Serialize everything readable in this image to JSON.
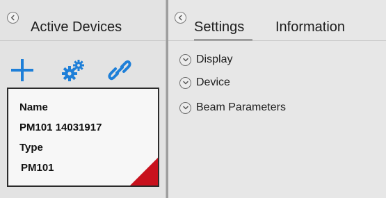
{
  "left_panel": {
    "title": "Active Devices",
    "toolbar": {
      "add_icon": "plus-icon",
      "settings_icon": "gears-icon",
      "connect_icon": "link-icon"
    },
    "device_card": {
      "name_label": "Name",
      "name_value": "PM101 14031917",
      "type_label": "Type",
      "type_value": "PM101",
      "corner_color": "#c8111d"
    }
  },
  "right_panel": {
    "tabs": [
      {
        "label": "Settings",
        "active": true
      },
      {
        "label": "Information",
        "active": false
      }
    ],
    "sections": [
      {
        "label": "Display"
      },
      {
        "label": "Device"
      },
      {
        "label": "Beam Parameters"
      }
    ]
  },
  "colors": {
    "accent_blue": "#1e7fd8",
    "alert_red": "#c8111d"
  }
}
